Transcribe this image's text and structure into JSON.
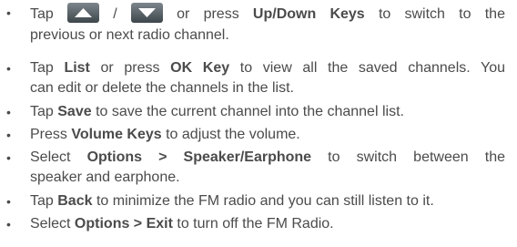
{
  "items": [
    {
      "t1": "Tap",
      "slash": "/",
      "t2": "or press",
      "b1": "Up/Down Keys",
      "t3": "to switch to the",
      "line2": "previous or next radio channel."
    },
    {
      "t1": "Tap",
      "b1": "List",
      "t2": "or press",
      "b2": "OK Key",
      "t3": "to view all the saved channels. You",
      "line2": "can edit or delete the channels in the list."
    },
    {
      "t1": "Tap",
      "b1": "Save",
      "t2": "to save the current channel into the channel list."
    },
    {
      "t1": "Press",
      "b1": "Volume Keys",
      "t2": "to adjust the volume."
    },
    {
      "t1": "Select",
      "b1": "Options > Speaker/Earphone",
      "t2": "to switch between the",
      "line2": "speaker and earphone."
    },
    {
      "t1": "Tap",
      "b1": "Back",
      "t2": "to minimize the FM radio and you can still listen to it."
    },
    {
      "t1": "Select",
      "b1": "Options > Exit",
      "t2": "to turn off the FM Radio."
    }
  ],
  "bullet": "•",
  "icons": [
    "up-arrow-key-icon",
    "down-arrow-key-icon"
  ],
  "colors": {
    "text": "#4b4b4b",
    "icon_bg": "#55606a"
  }
}
